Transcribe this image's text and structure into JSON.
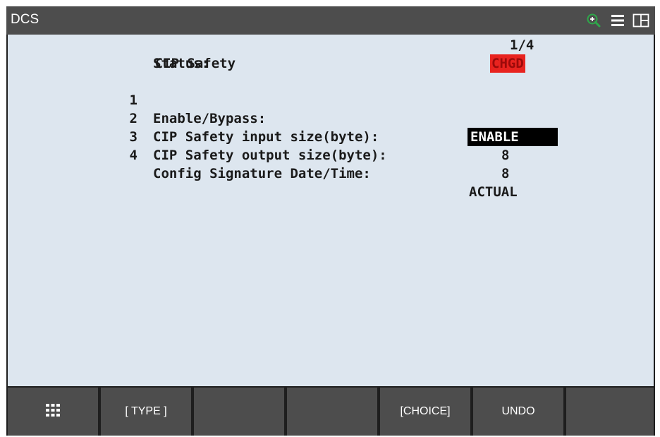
{
  "titlebar": {
    "title": "DCS",
    "icons": [
      "zoom-in-icon",
      "menu-icon",
      "split-view-icon"
    ]
  },
  "screen": {
    "header": {
      "label": "CIP Safety",
      "page": "1/4"
    },
    "status": {
      "label": "Status:",
      "value": "CHGD"
    },
    "items": [
      {
        "number": "1",
        "label": "Enable/Bypass:",
        "value": "ENABLE"
      },
      {
        "number": "2",
        "label": "CIP Safety input size(byte):",
        "value": "8"
      },
      {
        "number": "3",
        "label": "CIP Safety output size(byte):",
        "value": "8"
      },
      {
        "number": "4",
        "label": "Config Signature Date/Time:",
        "value": "ACTUAL"
      }
    ]
  },
  "function_keys": [
    {
      "label": "",
      "icon": "grid-menu-icon"
    },
    {
      "label": "[ TYPE ]"
    },
    {
      "label": ""
    },
    {
      "label": ""
    },
    {
      "label": "[CHOICE]"
    },
    {
      "label": "UNDO"
    },
    {
      "label": ""
    }
  ],
  "colors": {
    "titlebar": "#4d4d4d",
    "screen_bg": "#dde6ef",
    "status_badge": "#e8231f",
    "selected_cursor": "#000000",
    "zoom_icon": "#2ea84a"
  }
}
